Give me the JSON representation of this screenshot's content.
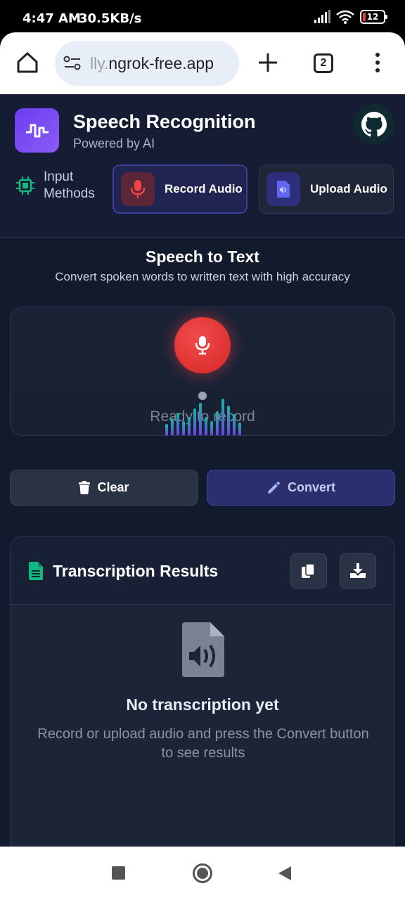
{
  "status_bar": {
    "time": "4:47 AM",
    "speed": "30.5KB/s",
    "battery": "12"
  },
  "browser": {
    "url_faded": "lly.",
    "url_main": "ngrok-free.app",
    "tab_count": "2"
  },
  "header": {
    "title": "Speech Recognition",
    "subtitle": "Powered by AI",
    "input_methods_label": "Input Methods",
    "record_label": "Record Audio",
    "upload_label": "Upload Audio"
  },
  "main": {
    "title": "Speech to Text",
    "subtitle": "Convert spoken words to written text with high accuracy",
    "status": "Ready to record",
    "clear_label": "Clear",
    "convert_label": "Convert"
  },
  "results": {
    "title": "Transcription Results",
    "empty_title": "No transcription yet",
    "empty_text": "Record or upload audio and press the Convert button to see results"
  },
  "colors": {
    "background": "#121a2e",
    "accent_purple": "#6d3df0",
    "record_red": "#e53935",
    "wave_teal": "#14b8a6"
  }
}
